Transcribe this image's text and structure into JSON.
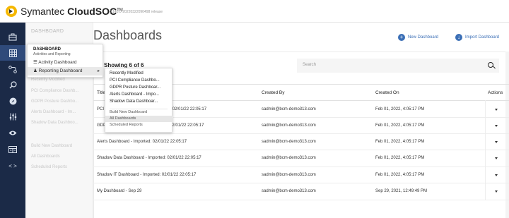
{
  "app": {
    "logo_text": "Symantec ",
    "logo_bold": "CloudSOC",
    "logo_tm": "TM",
    "version": "3.143.0-20220322090498 release"
  },
  "rail": {
    "icons": [
      "briefcase-icon",
      "grid-icon",
      "route-icon",
      "search-icon",
      "compass-icon",
      "controls-icon",
      "eye-icon",
      "list-icon",
      "code-icon"
    ]
  },
  "subnav": {
    "title": "DASHBOARD",
    "items": [
      "Recently Modified",
      "PCI Compliance Dashb...",
      "GDPR Posture Dashbo...",
      "Alerts Dashboard - Im...",
      "Shadow Data Dashboo...",
      "Build New Dashboard",
      "All Dashboards",
      "Scheduled Reports"
    ]
  },
  "flyout": {
    "heading": "DASHBOARD",
    "subheading": "Activities and Reporting",
    "activity": "Activity Dashboard",
    "reporting": "Reporting Dashboard"
  },
  "flyout2": {
    "items": [
      "Recently Modified",
      "PCI Compliance Dashbo...",
      "GDPR Posture Dashboar...",
      "Alerts Dashboard - Impo...",
      "Shadow Data Dashboar..."
    ],
    "actions": [
      "Build New Dashboard",
      "All Dashboards",
      "Scheduled Reports"
    ]
  },
  "main": {
    "title": "Dashboards",
    "new_label": "New Dashboard",
    "import_label": "Import Dashboard",
    "showing": "Showing 6 of 6",
    "search_placeholder": "Search",
    "columns": [
      "Title",
      "Created By",
      "Created On",
      "Actions"
    ],
    "rows": [
      {
        "title": "PCI Compliance Dashboard - Imported: 02/01/22 22:05:17",
        "by": "sadmin@bcm-demo313.com",
        "on": "Feb 01, 2022, 4:05:17 PM"
      },
      {
        "title": "GDPR Posture Dashboard - Imported: 02/01/22 22:05:17",
        "by": "sadmin@bcm-demo313.com",
        "on": "Feb 01, 2022, 4:05:17 PM"
      },
      {
        "title": "Alerts Dashboard - Imported: 02/01/22 22:05:17",
        "by": "sadmin@bcm-demo313.com",
        "on": "Feb 01, 2022, 4:05:17 PM"
      },
      {
        "title": "Shadow Data Dashboard - Imported: 02/01/22 22:05:17",
        "by": "sadmin@bcm-demo313.com",
        "on": "Feb 01, 2022, 4:05:17 PM"
      },
      {
        "title": "Shadow IT Dashboard - Imported: 02/01/22 22:05:17",
        "by": "sadmin@bcm-demo313.com",
        "on": "Feb 01, 2022, 4:05:17 PM"
      },
      {
        "title": "My Dashboard - Sep 29",
        "by": "sadmin@bcm-demo313.com",
        "on": "Sep 29, 2021, 12:49:49 PM"
      }
    ]
  },
  "colors": {
    "rail": "#1b2a47",
    "accent": "#3b6fb6",
    "logo": "#f5b700"
  }
}
